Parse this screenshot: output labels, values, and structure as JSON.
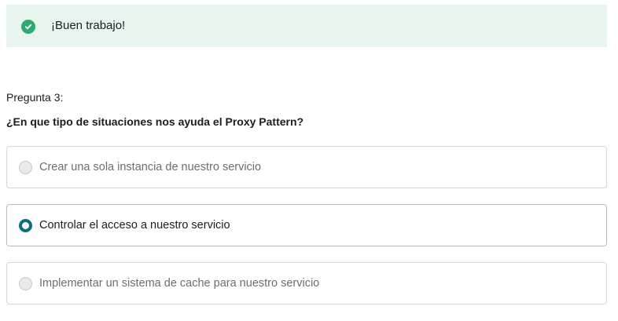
{
  "alert": {
    "message": "¡Buen trabajo!",
    "icon": "check-circle-icon",
    "status_color": "#2eaa6e"
  },
  "question": {
    "number_label": "Pregunta 3:",
    "text": "¿En que tipo de situaciones nos ayuda el Proxy Pattern?"
  },
  "options": [
    {
      "label": "Crear una sola instancia de nuestro servicio",
      "selected": false
    },
    {
      "label": "Controlar el acceso a nuestro servicio",
      "selected": true
    },
    {
      "label": "Implementar un sistema de cache para nuestro servicio",
      "selected": false
    }
  ],
  "colors": {
    "accent": "#0f6e7e",
    "alert_background": "#e8f5ef"
  }
}
